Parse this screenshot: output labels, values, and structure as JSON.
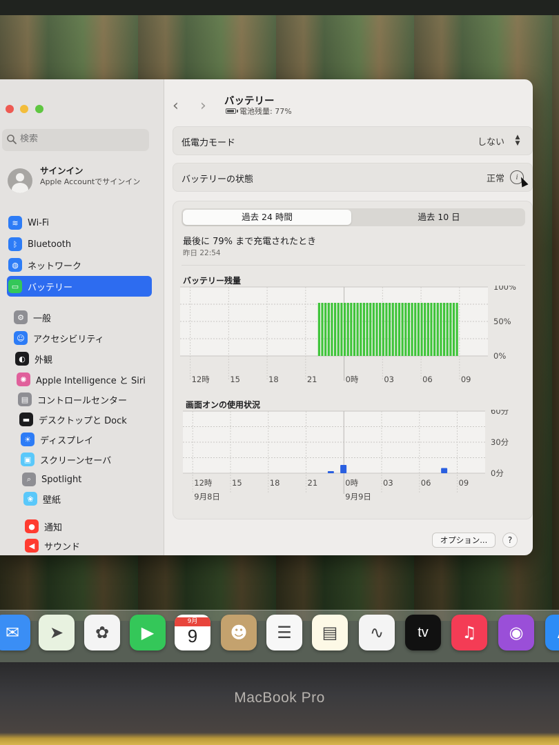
{
  "window": {
    "title": "バッテリー",
    "subtitle": "電池残量: 77%"
  },
  "sidebar": {
    "search_placeholder": "検索",
    "account": {
      "name": "サインイン",
      "subtitle": "Apple Accountでサインイン"
    },
    "items": [
      {
        "label": "Wi-Fi",
        "icon": "wifi-icon",
        "color": "#2d7cf6"
      },
      {
        "label": "Bluetooth",
        "icon": "bluetooth-icon",
        "color": "#2d7cf6"
      },
      {
        "label": "ネットワーク",
        "icon": "globe-icon",
        "color": "#2d7cf6"
      },
      {
        "label": "バッテリー",
        "icon": "battery-icon",
        "color": "#34c759",
        "selected": true
      },
      {
        "label": "一般",
        "icon": "gear-icon",
        "color": "#8e8e93"
      },
      {
        "label": "アクセシビリティ",
        "icon": "accessibility-icon",
        "color": "#2d7cf6"
      },
      {
        "label": "外観",
        "icon": "appearance-icon",
        "color": "#1c1c1e"
      },
      {
        "label": "Apple Intelligence と Siri",
        "icon": "siri-icon",
        "color": "#e0609b"
      },
      {
        "label": "コントロールセンター",
        "icon": "control-center-icon",
        "color": "#8e8e93"
      },
      {
        "label": "デスクトップと Dock",
        "icon": "dock-icon",
        "color": "#1c1c1e"
      },
      {
        "label": "ディスプレイ",
        "icon": "display-icon",
        "color": "#2d7cf6"
      },
      {
        "label": "スクリーンセーバ",
        "icon": "screensaver-icon",
        "color": "#5ac8fa"
      },
      {
        "label": "Spotlight",
        "icon": "spotlight-icon",
        "color": "#8e8e93"
      },
      {
        "label": "壁紙",
        "icon": "wallpaper-icon",
        "color": "#5ac8fa"
      },
      {
        "label": "通知",
        "icon": "notification-icon",
        "color": "#ff3b30"
      },
      {
        "label": "サウンド",
        "icon": "sound-icon",
        "color": "#ff3b30"
      }
    ]
  },
  "main": {
    "low_power": {
      "label": "低電力モード",
      "value": "しない"
    },
    "health": {
      "label": "バッテリーの状態",
      "value": "正常"
    },
    "tabs": [
      {
        "label": "過去 24 時間",
        "active": true
      },
      {
        "label": "過去 10 日",
        "active": false
      }
    ],
    "last_charged": "最後に 79% まで充電されたとき",
    "last_charged_time": "昨日 22:54",
    "options_label": "オプション...",
    "help_label": "?"
  },
  "chart_data": [
    {
      "type": "bar",
      "title": "バッテリー残量",
      "x_tick_labels": [
        "12時",
        "15",
        "18",
        "21",
        "0時",
        "03",
        "06",
        "09"
      ],
      "y_tick_labels": [
        "100%",
        "50%",
        "0%"
      ],
      "ylim": [
        0,
        100
      ],
      "color": "#3fc43a",
      "x_hours": [
        21.75,
        22.0,
        22.25,
        22.5,
        22.75,
        23.0,
        23.25,
        23.5,
        23.75,
        24.0,
        24.25,
        24.5,
        24.75,
        25.0,
        25.25,
        25.5,
        25.75,
        26.0,
        26.25,
        26.5,
        26.75,
        27.0,
        27.25,
        27.5,
        27.75,
        28.0,
        28.25,
        28.5,
        28.75,
        29.0,
        29.25,
        29.5,
        29.75,
        30.0,
        30.25,
        30.5,
        30.75,
        31.0,
        31.25,
        31.5,
        31.75,
        32.0,
        32.25,
        32.5
      ],
      "values": [
        77,
        77,
        77,
        77,
        77,
        77,
        77,
        77,
        77,
        77,
        77,
        77,
        77,
        77,
        77,
        77,
        77,
        77,
        77,
        77,
        77,
        77,
        77,
        77,
        77,
        77,
        77,
        77,
        77,
        77,
        77,
        77,
        77,
        77,
        77,
        77,
        77,
        77,
        77,
        77,
        77,
        77,
        77,
        77
      ]
    },
    {
      "type": "bar",
      "title": "画面オンの使用状況",
      "x_tick_labels": [
        "12時",
        "15",
        "18",
        "21",
        "0時",
        "03",
        "06",
        "09"
      ],
      "date_labels": [
        "9月8日",
        "9月9日"
      ],
      "y_tick_labels": [
        "60分",
        "30分",
        "0分"
      ],
      "ylim": [
        0,
        60
      ],
      "color": "#2a5fe0",
      "x_hours": [
        22.5,
        23.5,
        31.5
      ],
      "values": [
        2,
        8,
        5
      ]
    }
  ],
  "dock": {
    "apps": [
      {
        "name": "mail-icon",
        "color": "#3a8ef5"
      },
      {
        "name": "maps-icon",
        "color": "#e8f2e0"
      },
      {
        "name": "photos-icon",
        "color": "#f4f4f4"
      },
      {
        "name": "facetime-icon",
        "color": "#34c759"
      },
      {
        "name": "calendar-icon",
        "color": "#ffffff",
        "month": "9月",
        "day": "9"
      },
      {
        "name": "contacts-icon",
        "color": "#c4a26e"
      },
      {
        "name": "reminders-icon",
        "color": "#f7f7f7"
      },
      {
        "name": "notes-icon",
        "color": "#fdf9e6"
      },
      {
        "name": "freeform-icon",
        "color": "#f4f4f4"
      },
      {
        "name": "tv-icon",
        "color": "#111111",
        "label": "tv"
      },
      {
        "name": "music-icon",
        "color": "#f43c55"
      },
      {
        "name": "podcasts-icon",
        "color": "#9a4fd8"
      },
      {
        "name": "appstore-icon",
        "color": "#2d8cf6"
      }
    ]
  },
  "hardware": {
    "label": "MacBook Pro"
  }
}
